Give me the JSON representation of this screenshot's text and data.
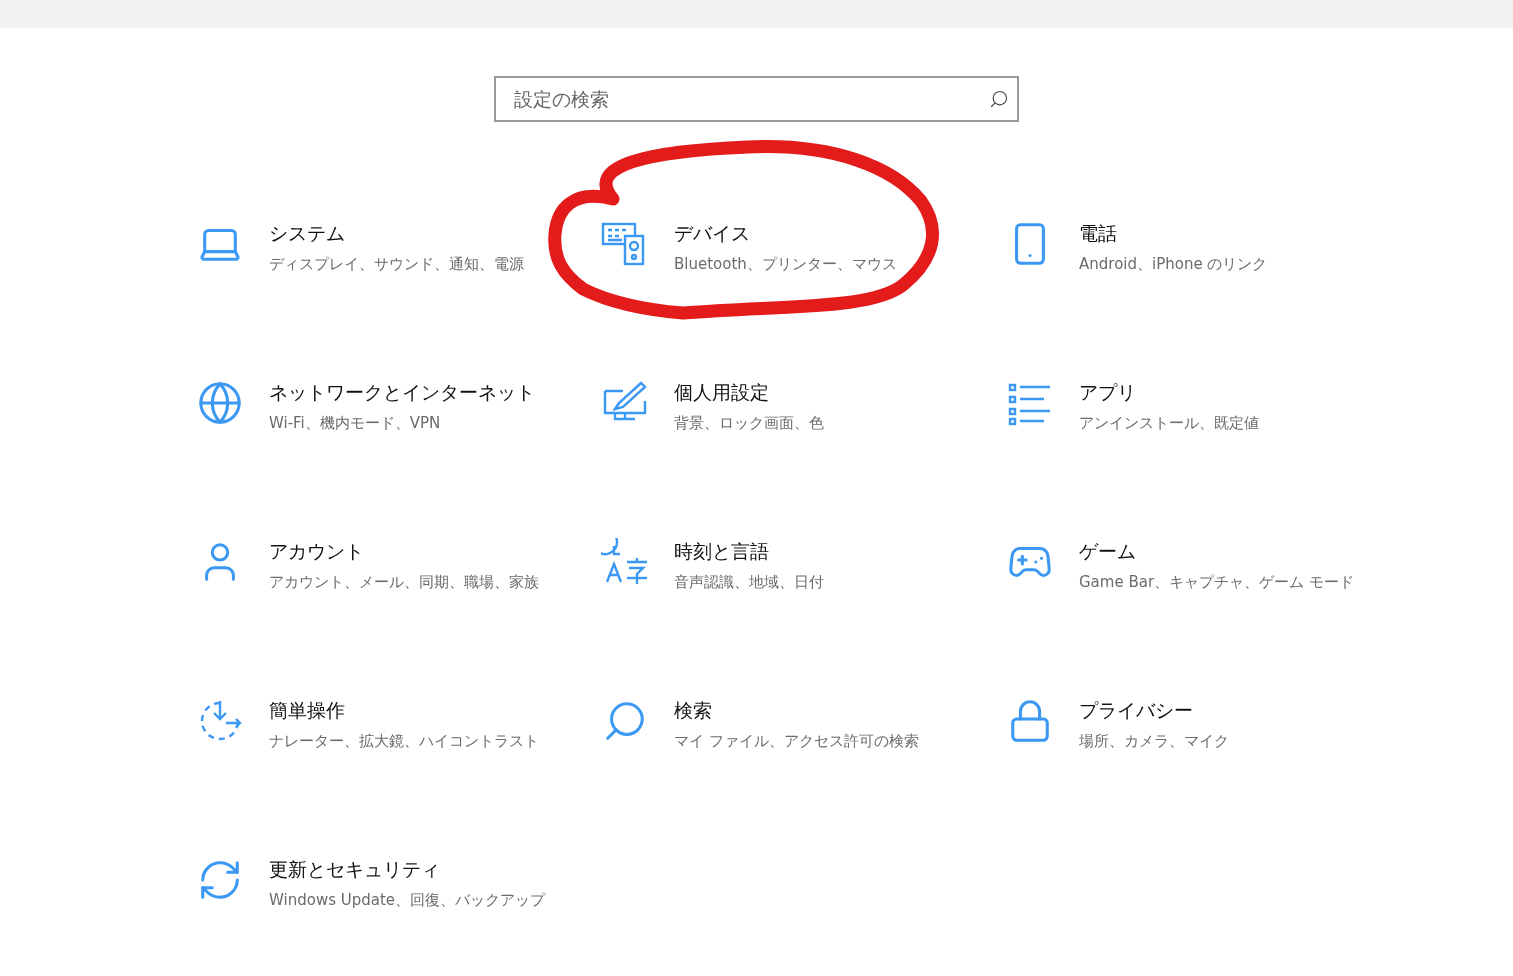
{
  "search": {
    "placeholder": "設定の検索"
  },
  "tiles": [
    {
      "kind": "system",
      "title": "システム",
      "description": "ディスプレイ、サウンド、通知、電源"
    },
    {
      "kind": "devices",
      "title": "デバイス",
      "description": "Bluetooth、プリンター、マウス",
      "annotation": {
        "kind": "circle",
        "color": "#e31b1b"
      }
    },
    {
      "kind": "phone",
      "title": "電話",
      "description": "Android、iPhone のリンク"
    },
    {
      "kind": "network",
      "title": "ネットワークとインターネット",
      "description": "Wi-Fi、機内モード、VPN"
    },
    {
      "kind": "personalization",
      "title": "個人用設定",
      "description": "背景、ロック画面、色"
    },
    {
      "kind": "apps",
      "title": "アプリ",
      "description": "アンインストール、既定値"
    },
    {
      "kind": "accounts",
      "title": "アカウント",
      "description": "アカウント、メール、同期、職場、家族"
    },
    {
      "kind": "time",
      "title": "時刻と言語",
      "description": "音声認識、地域、日付"
    },
    {
      "kind": "gaming",
      "title": "ゲーム",
      "description": "Game Bar、キャプチャ、ゲーム モード"
    },
    {
      "kind": "ease",
      "title": "簡単操作",
      "description": "ナレーター、拡大鏡、ハイコントラスト"
    },
    {
      "kind": "search",
      "title": "検索",
      "description": "マイ ファイル、アクセス許可の検索"
    },
    {
      "kind": "privacy",
      "title": "プライバシー",
      "description": "場所、カメラ、マイク"
    },
    {
      "kind": "update",
      "title": "更新とセキュリティ",
      "description": "Windows Update、回復、バックアップ"
    }
  ]
}
